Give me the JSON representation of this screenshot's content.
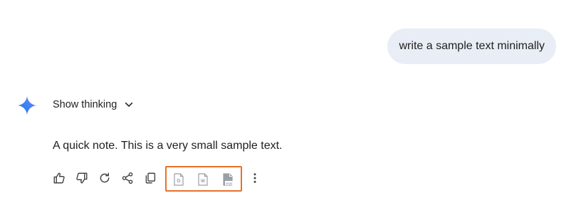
{
  "conversation": {
    "user_prompt": "write a sample text minimally",
    "thinking_toggle_label": "Show thinking",
    "response_text": "A quick note. This is a very small sample text."
  },
  "actions": [
    {
      "name": "thumbs-up-button",
      "icon": "thumbs-up-icon"
    },
    {
      "name": "thumbs-down-button",
      "icon": "thumbs-down-icon"
    },
    {
      "name": "regenerate-button",
      "icon": "refresh-icon"
    },
    {
      "name": "share-button",
      "icon": "share-icon"
    },
    {
      "name": "copy-button",
      "icon": "copy-icon"
    },
    {
      "name": "export-google-docs-button",
      "icon": "google-docs-icon",
      "glyph": "G"
    },
    {
      "name": "export-word-button",
      "icon": "word-doc-icon",
      "glyph": "W"
    },
    {
      "name": "export-pdf-button",
      "icon": "pdf-icon",
      "glyph": "PDF"
    },
    {
      "name": "more-options-button",
      "icon": "more-vert-icon"
    }
  ],
  "colors": {
    "user_bubble_bg": "#e9eef6",
    "text": "#1f1f1f",
    "icon": "#444746",
    "export_icon": "#9aa0a6",
    "highlight_border": "#e8702a",
    "gem_gradient_start": "#4285f4",
    "gem_gradient_end": "#9b72cb"
  }
}
